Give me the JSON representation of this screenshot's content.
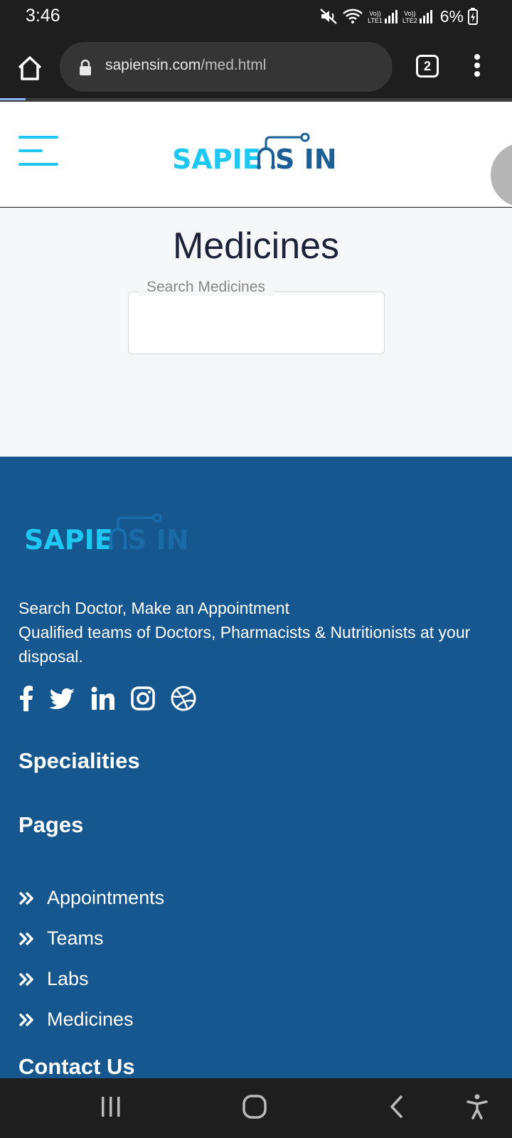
{
  "status": {
    "time": "3:46",
    "sim1": "LTE1",
    "sim2": "LTE2",
    "battery": "6%"
  },
  "browser": {
    "url_host": "sapiensin.com",
    "url_path": "/med.html",
    "tab_count": "2"
  },
  "header": {
    "logo_text": "SAPIENS IN"
  },
  "main": {
    "title": "Medicines",
    "search_label": "Search Medicines"
  },
  "footer": {
    "logo_text": "SAPIENS IN",
    "desc_line1": "Search Doctor, Make an Appointment",
    "desc_line2": "Qualified teams of Doctors, Pharmacists & Nutritionists at your disposal.",
    "socials": [
      "facebook-icon",
      "twitter-icon",
      "linkedin-icon",
      "instagram-icon",
      "dribbble-icon"
    ],
    "specialities_heading": "Specialities",
    "pages_heading": "Pages",
    "pages": [
      {
        "label": "Appointments"
      },
      {
        "label": "Teams"
      },
      {
        "label": "Labs"
      },
      {
        "label": "Medicines"
      }
    ],
    "contact_heading": "Contact Us"
  },
  "colors": {
    "accent_cyan": "#1ec8f0",
    "brand_blue": "#1a5f96",
    "footer_bg": "#16578f",
    "title_dark": "#1c2238"
  }
}
